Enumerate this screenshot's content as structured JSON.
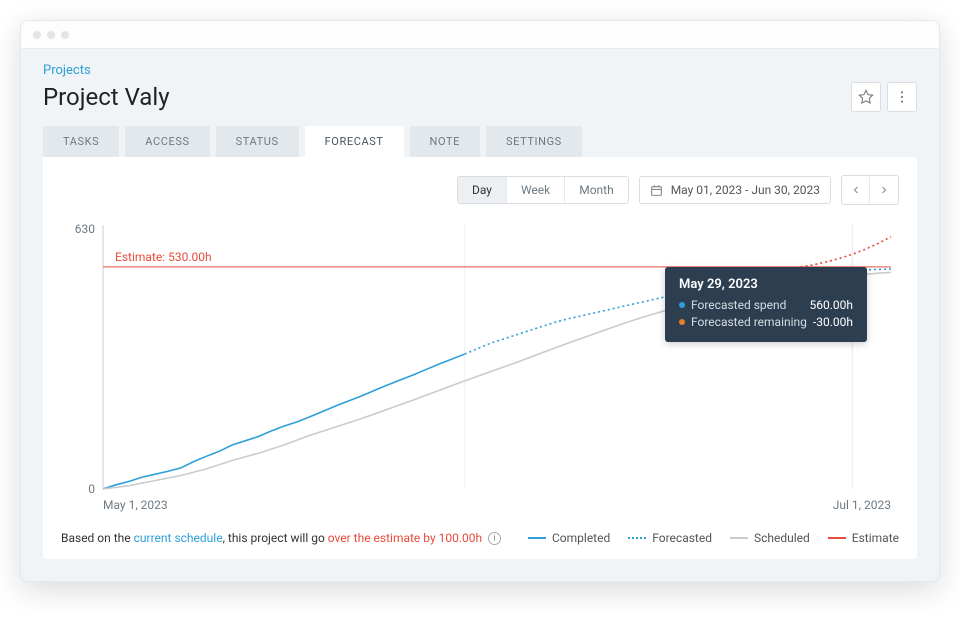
{
  "breadcrumb": "Projects",
  "title": "Project Valy",
  "tabs": [
    {
      "label": "TASKS",
      "active": false
    },
    {
      "label": "ACCESS",
      "active": false
    },
    {
      "label": "STATUS",
      "active": false
    },
    {
      "label": "FORECAST",
      "active": true
    },
    {
      "label": "NOTE",
      "active": false
    },
    {
      "label": "SETTINGS",
      "active": false
    }
  ],
  "granularity": [
    {
      "label": "Day",
      "active": true
    },
    {
      "label": "Week",
      "active": false
    },
    {
      "label": "Month",
      "active": false
    }
  ],
  "date_range": "May 01, 2023 - Jun 30, 2023",
  "insight": {
    "prefix": "Based on the ",
    "schedule_link": "current schedule",
    "mid": ", this project will go ",
    "over_text": "over the estimate by 100.00h"
  },
  "legend": {
    "completed": "Completed",
    "forecasted": "Forecasted",
    "scheduled": "Scheduled",
    "estimate": "Estimate"
  },
  "tooltip": {
    "date": "May 29, 2023",
    "rows": [
      {
        "color": "#2e9fd8",
        "label": "Forecasted spend",
        "value": "560.00h"
      },
      {
        "color": "#e67e22",
        "label": "Forecasted remaining",
        "value": "-30.00h"
      }
    ]
  },
  "chart_data": {
    "type": "line",
    "xlabel_start": "May 1, 2023",
    "xlabel_end": "Jul 1, 2023",
    "ylim": [
      0,
      630
    ],
    "ytick_top": "630",
    "ytick_bottom": "0",
    "estimate_value": 530,
    "estimate_label": "Estimate: 530.00h",
    "x_days": 61,
    "series": [
      {
        "name": "Completed",
        "color": "#2e9fd8",
        "style": "solid",
        "points": [
          {
            "x": 0,
            "y": 0
          },
          {
            "x": 1,
            "y": 10
          },
          {
            "x": 2,
            "y": 18
          },
          {
            "x": 3,
            "y": 28
          },
          {
            "x": 4,
            "y": 35
          },
          {
            "x": 5,
            "y": 42
          },
          {
            "x": 6,
            "y": 50
          },
          {
            "x": 7,
            "y": 65
          },
          {
            "x": 8,
            "y": 78
          },
          {
            "x": 9,
            "y": 90
          },
          {
            "x": 10,
            "y": 105
          },
          {
            "x": 11,
            "y": 115
          },
          {
            "x": 12,
            "y": 125
          },
          {
            "x": 13,
            "y": 138
          },
          {
            "x": 14,
            "y": 150
          },
          {
            "x": 15,
            "y": 160
          },
          {
            "x": 16,
            "y": 172
          },
          {
            "x": 17,
            "y": 185
          },
          {
            "x": 18,
            "y": 198
          },
          {
            "x": 19,
            "y": 210
          },
          {
            "x": 20,
            "y": 222
          },
          {
            "x": 21,
            "y": 235
          },
          {
            "x": 22,
            "y": 248
          },
          {
            "x": 23,
            "y": 260
          },
          {
            "x": 24,
            "y": 272
          },
          {
            "x": 25,
            "y": 285
          },
          {
            "x": 26,
            "y": 298
          },
          {
            "x": 27,
            "y": 310
          },
          {
            "x": 28,
            "y": 322
          }
        ]
      },
      {
        "name": "Forecasted",
        "color": "#2e9fd8",
        "style": "dotted",
        "points": [
          {
            "x": 28,
            "y": 322
          },
          {
            "x": 29,
            "y": 335
          },
          {
            "x": 30,
            "y": 348
          },
          {
            "x": 31,
            "y": 358
          },
          {
            "x": 32,
            "y": 368
          },
          {
            "x": 33,
            "y": 378
          },
          {
            "x": 34,
            "y": 388
          },
          {
            "x": 35,
            "y": 398
          },
          {
            "x": 36,
            "y": 406
          },
          {
            "x": 37,
            "y": 413
          },
          {
            "x": 38,
            "y": 420
          },
          {
            "x": 39,
            "y": 427
          },
          {
            "x": 40,
            "y": 434
          },
          {
            "x": 41,
            "y": 441
          },
          {
            "x": 42,
            "y": 448
          },
          {
            "x": 43,
            "y": 455
          },
          {
            "x": 44,
            "y": 462
          },
          {
            "x": 45,
            "y": 469
          },
          {
            "x": 46,
            "y": 476
          },
          {
            "x": 47,
            "y": 483
          },
          {
            "x": 48,
            "y": 490
          },
          {
            "x": 49,
            "y": 495
          },
          {
            "x": 50,
            "y": 500
          },
          {
            "x": 51,
            "y": 504
          },
          {
            "x": 52,
            "y": 508
          },
          {
            "x": 53,
            "y": 511
          },
          {
            "x": 54,
            "y": 514
          },
          {
            "x": 55,
            "y": 517
          },
          {
            "x": 56,
            "y": 519
          },
          {
            "x": 57,
            "y": 521
          },
          {
            "x": 58,
            "y": 522
          },
          {
            "x": 59,
            "y": 523
          },
          {
            "x": 60,
            "y": 524
          },
          {
            "x": 61,
            "y": 525
          }
        ]
      },
      {
        "name": "Scheduled",
        "color": "#c8ccd0",
        "style": "solid",
        "points": [
          {
            "x": 0,
            "y": 0
          },
          {
            "x": 2,
            "y": 8
          },
          {
            "x": 4,
            "y": 20
          },
          {
            "x": 6,
            "y": 32
          },
          {
            "x": 8,
            "y": 48
          },
          {
            "x": 10,
            "y": 68
          },
          {
            "x": 12,
            "y": 85
          },
          {
            "x": 14,
            "y": 105
          },
          {
            "x": 16,
            "y": 128
          },
          {
            "x": 18,
            "y": 148
          },
          {
            "x": 20,
            "y": 168
          },
          {
            "x": 22,
            "y": 190
          },
          {
            "x": 24,
            "y": 212
          },
          {
            "x": 26,
            "y": 235
          },
          {
            "x": 28,
            "y": 258
          },
          {
            "x": 30,
            "y": 280
          },
          {
            "x": 32,
            "y": 302
          },
          {
            "x": 34,
            "y": 325
          },
          {
            "x": 36,
            "y": 348
          },
          {
            "x": 38,
            "y": 370
          },
          {
            "x": 40,
            "y": 392
          },
          {
            "x": 42,
            "y": 412
          },
          {
            "x": 44,
            "y": 430
          },
          {
            "x": 46,
            "y": 448
          },
          {
            "x": 48,
            "y": 465
          },
          {
            "x": 50,
            "y": 478
          },
          {
            "x": 52,
            "y": 488
          },
          {
            "x": 54,
            "y": 497
          },
          {
            "x": 56,
            "y": 504
          },
          {
            "x": 58,
            "y": 510
          },
          {
            "x": 60,
            "y": 515
          },
          {
            "x": 61,
            "y": 517
          }
        ]
      },
      {
        "name": "EstimateOverrun",
        "color": "#e74c3c",
        "style": "dotted",
        "points": [
          {
            "x": 54,
            "y": 530
          },
          {
            "x": 55,
            "y": 535
          },
          {
            "x": 56,
            "y": 542
          },
          {
            "x": 57,
            "y": 550
          },
          {
            "x": 58,
            "y": 560
          },
          {
            "x": 59,
            "y": 572
          },
          {
            "x": 60,
            "y": 586
          },
          {
            "x": 61,
            "y": 602
          }
        ]
      }
    ]
  }
}
